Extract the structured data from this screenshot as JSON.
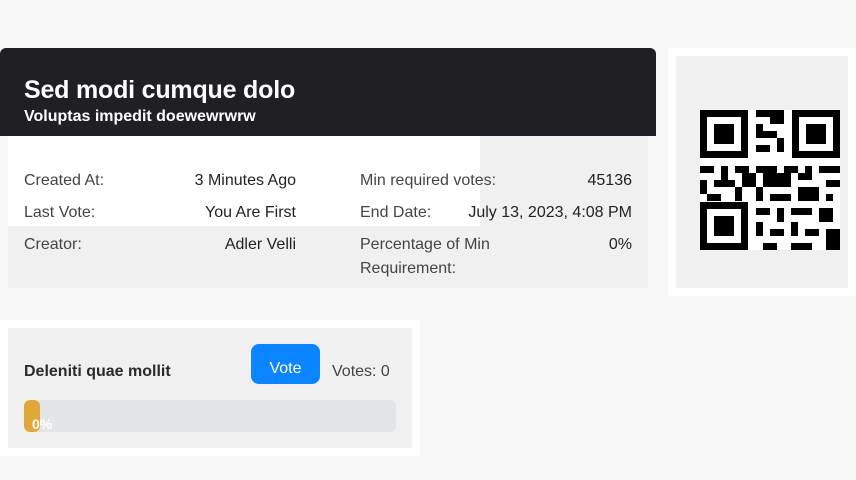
{
  "poll": {
    "title": "Sed modi cumque dolo",
    "subtitle": "Voluptas impedit doewewrwrw",
    "fields": {
      "created_at": {
        "label": "Created At:",
        "value": "3 Minutes Ago"
      },
      "last_vote": {
        "label": "Last Vote:",
        "value": "You Are First"
      },
      "creator": {
        "label": "Creator:",
        "value": "Adler Velli"
      },
      "min_votes": {
        "label": "Min required votes:",
        "value": "45136"
      },
      "end_date": {
        "label": "End Date:",
        "value": "July 13, 2023, 4:08 PM"
      },
      "percentage": {
        "label_line1": "Percentage of Min",
        "label_line2": "Requirement:",
        "value": "0%"
      }
    }
  },
  "qr": {
    "icon": "qr-code-icon"
  },
  "option": {
    "name": "Deleniti quae mollit",
    "vote_label": "Vote",
    "votes_text": "Votes: 0",
    "progress_percent": 0,
    "progress_text": "0%",
    "colors": {
      "button": "#0a84ff",
      "progress": "#e0a83a",
      "track": "#e4e5e7"
    }
  }
}
